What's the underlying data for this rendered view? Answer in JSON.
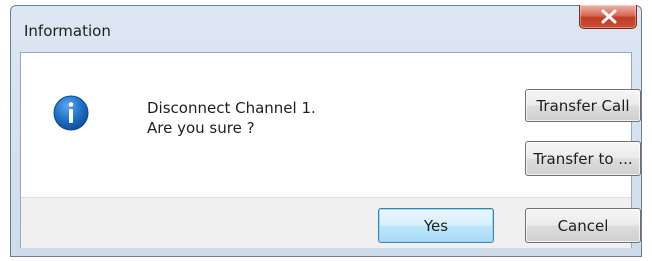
{
  "dialog": {
    "title": "Information",
    "close_icon": "close-x-icon",
    "message_icon": "information-icon",
    "message_lines": [
      "Disconnect Channel 1.",
      "Are you sure ?"
    ],
    "buttons": {
      "transfer_call": "Transfer Call",
      "transfer_to": "Transfer to ...",
      "yes": "Yes",
      "cancel": "Cancel"
    },
    "default_button": "Yes"
  },
  "colors": {
    "close_button": "#c94e34",
    "info_icon": "#1f6fc5",
    "default_button_border": "#3c7fb1",
    "frame": "#dde7f3"
  }
}
